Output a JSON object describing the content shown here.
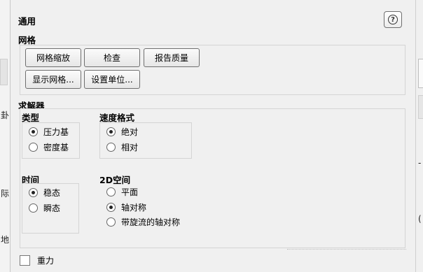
{
  "left_edge_glyphs": [
    "卦",
    "际",
    "地"
  ],
  "right_edge_glyphs": [
    "-",
    "("
  ],
  "header": {
    "title": "通用",
    "help_icon": "question-circle-icon",
    "help_label": "?"
  },
  "mesh": {
    "title": "网格",
    "buttons": [
      "网格缩放",
      "检查",
      "报告质量",
      "显示网格...",
      "设置单位..."
    ]
  },
  "solver": {
    "title": "求解器",
    "type": {
      "title": "类型",
      "options": [
        "压力基",
        "密度基"
      ],
      "selected": 0
    },
    "velocity": {
      "title": "速度格式",
      "options": [
        "绝对",
        "相对"
      ],
      "selected": 0
    },
    "time": {
      "title": "时间",
      "options": [
        "稳态",
        "瞬态"
      ],
      "selected": 0
    },
    "space2d": {
      "title": "2D空间",
      "options": [
        "平面",
        "轴对称",
        "带旋流的轴对称"
      ],
      "selected": 1
    }
  },
  "gravity": {
    "label": "重力",
    "checked": false
  }
}
